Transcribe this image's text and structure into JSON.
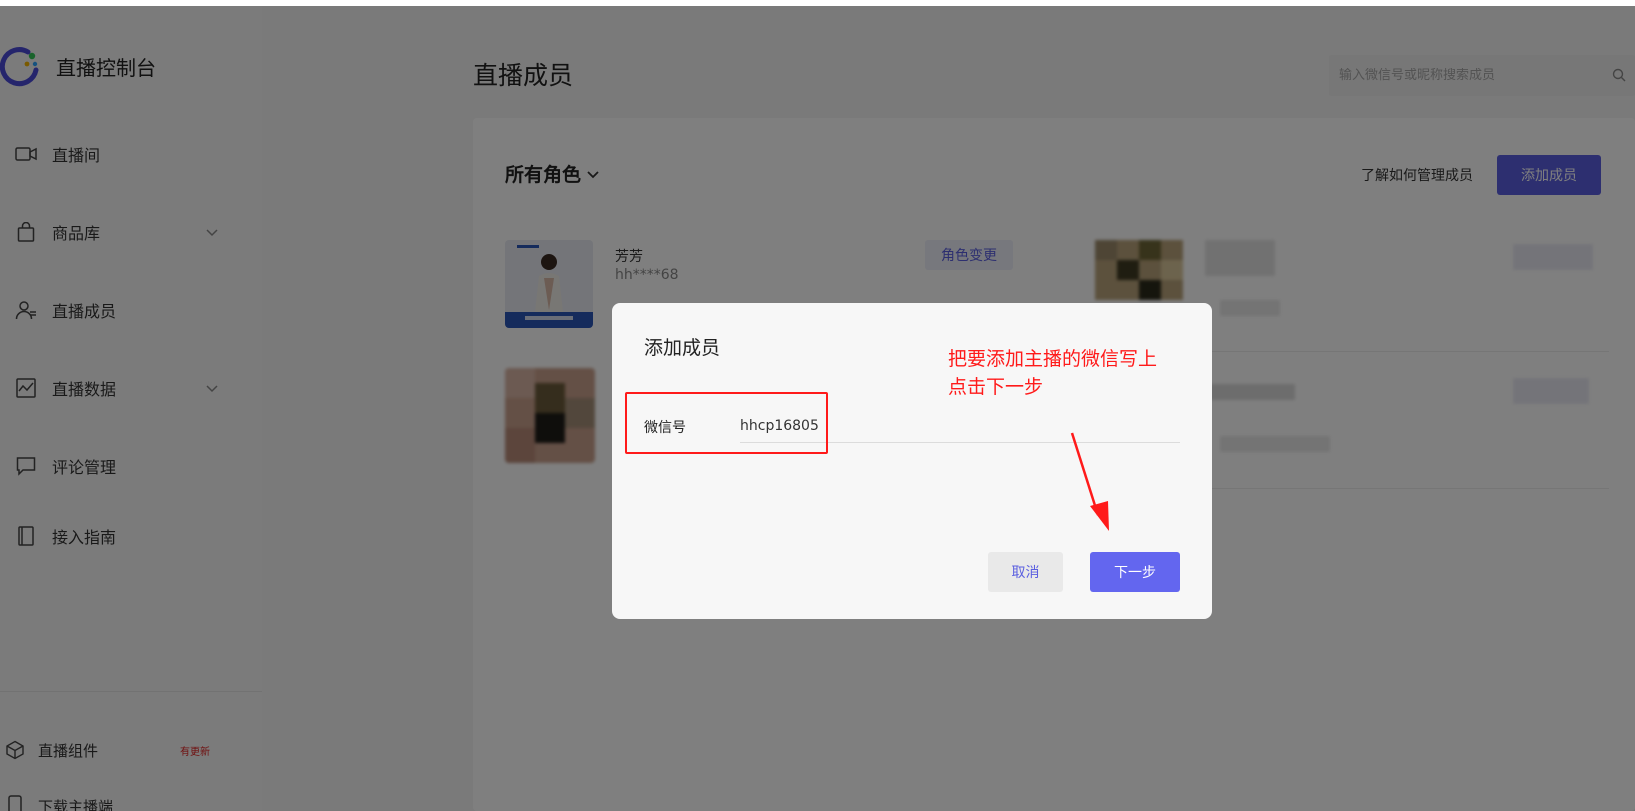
{
  "app": {
    "title": "直播控制台"
  },
  "sidebar": {
    "items": [
      {
        "label": "直播间",
        "icon": "video-camera-icon"
      },
      {
        "label": "商品库",
        "icon": "shopping-bag-icon",
        "expandable": true
      },
      {
        "label": "直播成员",
        "icon": "user-members-icon"
      },
      {
        "label": "直播数据",
        "icon": "chart-icon",
        "expandable": true
      },
      {
        "label": "评论管理",
        "icon": "comment-icon"
      },
      {
        "label": "接入指南",
        "icon": "book-icon"
      }
    ],
    "bottom_items": [
      {
        "label": "直播组件",
        "icon": "cube-icon",
        "badge": "有更新"
      },
      {
        "label": "下载主播端",
        "icon": "phone-icon"
      }
    ]
  },
  "header": {
    "title": "直播成员",
    "search_placeholder": "输入微信号或昵称搜索成员"
  },
  "toolbar": {
    "role_filter": "所有角色",
    "learn_link": "了解如何管理成员",
    "add_button": "添加成员"
  },
  "members": [
    {
      "name": "芳芳",
      "id": "hh****68",
      "role_button": "角色变更"
    }
  ],
  "modal": {
    "title": "添加成员",
    "field_label": "微信号",
    "field_value": "hhcp16805",
    "annotation_line1": "把要添加主播的微信写上",
    "annotation_line2": "点击下一步",
    "cancel_label": "取消",
    "next_label": "下一步"
  },
  "colors": {
    "accent": "#5b5fe0",
    "annotation": "#ff1a1a",
    "badge": "#e02020"
  }
}
